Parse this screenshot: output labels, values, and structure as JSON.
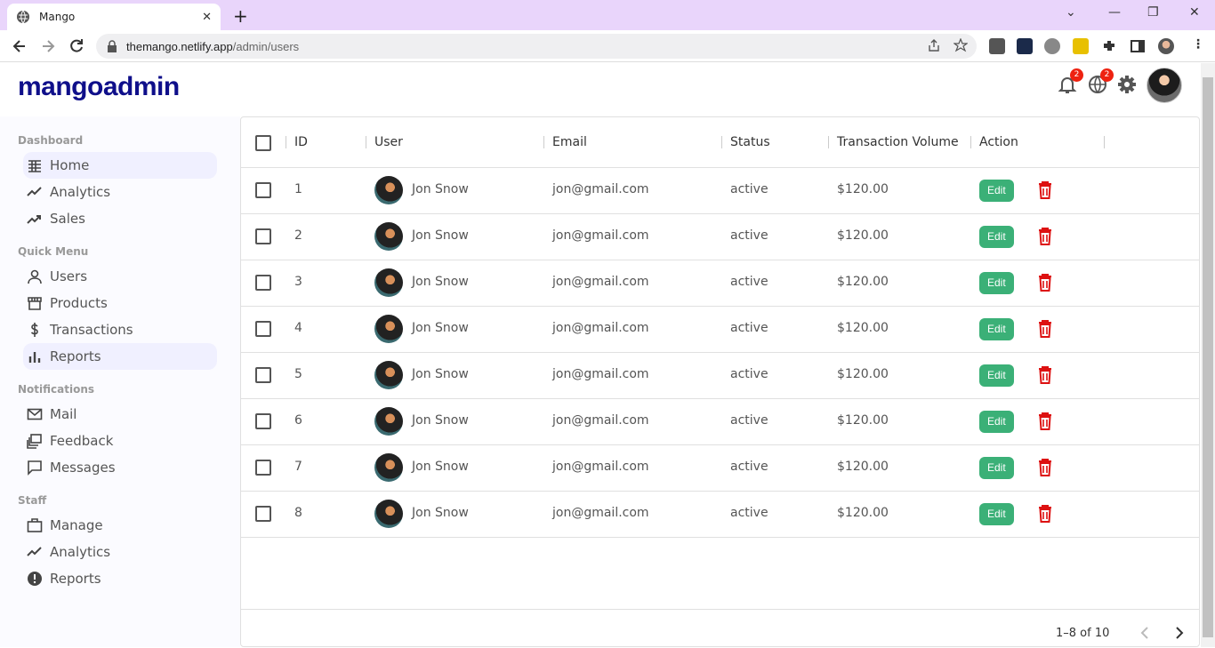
{
  "browser": {
    "tab_title": "Mango",
    "url_host": "themango.netlify.app",
    "url_path": "/admin/users"
  },
  "app": {
    "logo": "mangoadmin",
    "notifications_badge": "2",
    "language_badge": "2"
  },
  "sidebar": {
    "sections": [
      {
        "title": "Dashboard",
        "items": [
          {
            "label": "Home",
            "icon": "table-icon",
            "active": true
          },
          {
            "label": "Analytics",
            "icon": "line-chart-icon"
          },
          {
            "label": "Sales",
            "icon": "trending-up-icon"
          }
        ]
      },
      {
        "title": "Quick Menu",
        "items": [
          {
            "label": "Users",
            "icon": "user-icon"
          },
          {
            "label": "Products",
            "icon": "storefront-icon"
          },
          {
            "label": "Transactions",
            "icon": "dollar-icon"
          },
          {
            "label": "Reports",
            "icon": "bar-chart-icon",
            "active": true
          }
        ]
      },
      {
        "title": "Notifications",
        "items": [
          {
            "label": "Mail",
            "icon": "mail-icon"
          },
          {
            "label": "Feedback",
            "icon": "feedback-icon"
          },
          {
            "label": "Messages",
            "icon": "chat-icon"
          }
        ]
      },
      {
        "title": "Staff",
        "items": [
          {
            "label": "Manage",
            "icon": "briefcase-icon"
          },
          {
            "label": "Analytics",
            "icon": "line-chart-icon"
          },
          {
            "label": "Reports",
            "icon": "alert-icon"
          }
        ]
      }
    ]
  },
  "table": {
    "columns": [
      "ID",
      "User",
      "Email",
      "Status",
      "Transaction Volume",
      "Action"
    ],
    "rows": [
      {
        "id": "1",
        "user": "Jon Snow",
        "email": "jon@gmail.com",
        "status": "active",
        "volume": "$120.00"
      },
      {
        "id": "2",
        "user": "Jon Snow",
        "email": "jon@gmail.com",
        "status": "active",
        "volume": "$120.00"
      },
      {
        "id": "3",
        "user": "Jon Snow",
        "email": "jon@gmail.com",
        "status": "active",
        "volume": "$120.00"
      },
      {
        "id": "4",
        "user": "Jon Snow",
        "email": "jon@gmail.com",
        "status": "active",
        "volume": "$120.00"
      },
      {
        "id": "5",
        "user": "Jon Snow",
        "email": "jon@gmail.com",
        "status": "active",
        "volume": "$120.00"
      },
      {
        "id": "6",
        "user": "Jon Snow",
        "email": "jon@gmail.com",
        "status": "active",
        "volume": "$120.00"
      },
      {
        "id": "7",
        "user": "Jon Snow",
        "email": "jon@gmail.com",
        "status": "active",
        "volume": "$120.00"
      },
      {
        "id": "8",
        "user": "Jon Snow",
        "email": "jon@gmail.com",
        "status": "active",
        "volume": "$120.00"
      }
    ],
    "edit_label": "Edit",
    "pagination": "1–8 of 10"
  },
  "colors": {
    "accent": "#3bb077",
    "delete": "#dd1111",
    "logo": "#0f0f8a",
    "tabbar": "#e9d5fb"
  }
}
